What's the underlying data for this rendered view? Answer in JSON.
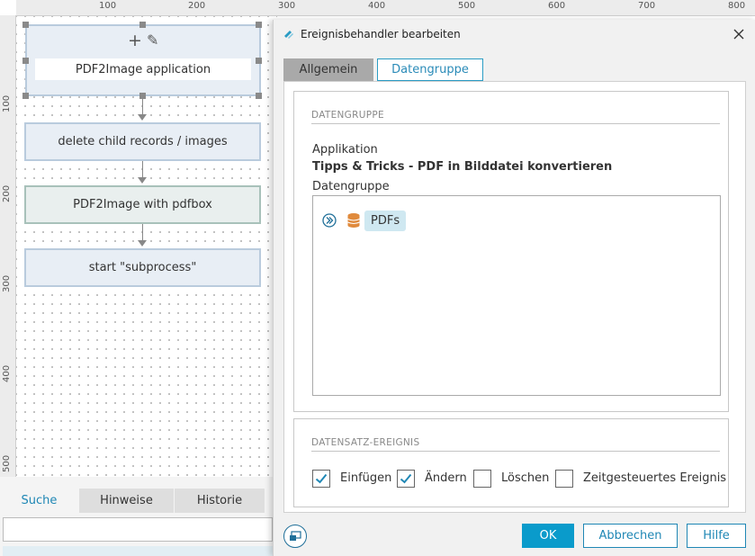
{
  "ruler": {
    "top_labels": [
      "100",
      "200",
      "300",
      "400",
      "500",
      "600",
      "700",
      "800"
    ],
    "left_labels": [
      "100",
      "200",
      "300",
      "400",
      "500"
    ]
  },
  "flow": {
    "nodes": [
      {
        "label": "PDF2Image application"
      },
      {
        "label": "delete child records / images"
      },
      {
        "label": "PDF2Image with pdfbox"
      },
      {
        "label": "start \"subprocess\""
      }
    ],
    "add_symbol": "+",
    "edit_symbol": "✎"
  },
  "bottom_tabs": [
    "Suche",
    "Hinweise",
    "Historie"
  ],
  "dialog": {
    "title": "Ereignisbehandler bearbeiten",
    "tabs": [
      "Allgemein",
      "Datengruppe"
    ],
    "datengruppe_section": {
      "title": "DATENGRUPPE",
      "applikation_label": "Applikation",
      "applikation_value": "Tipps & Tricks - PDF in Bilddatei konvertieren",
      "datengruppe_label": "Datengruppe",
      "tree_item": "PDFs"
    },
    "ereignis_section": {
      "title": "DATENSATZ-EREIGNIS",
      "checkboxes": [
        {
          "label": "Einfügen",
          "checked": true
        },
        {
          "label": "Ändern",
          "checked": true
        },
        {
          "label": "Löschen",
          "checked": false
        },
        {
          "label": "Zeitgesteuertes Ereignis",
          "checked": false
        }
      ]
    },
    "buttons": {
      "ok": "OK",
      "cancel": "Abbrechen",
      "help": "Hilfe"
    }
  },
  "colors": {
    "accent": "#0a9bcb",
    "accent_text": "#1f87b5",
    "node_fill": "#e8eef5",
    "node_border": "#b9cbdd",
    "pill_bg": "#cfe8f1",
    "db_icon": "#e08a3c"
  }
}
